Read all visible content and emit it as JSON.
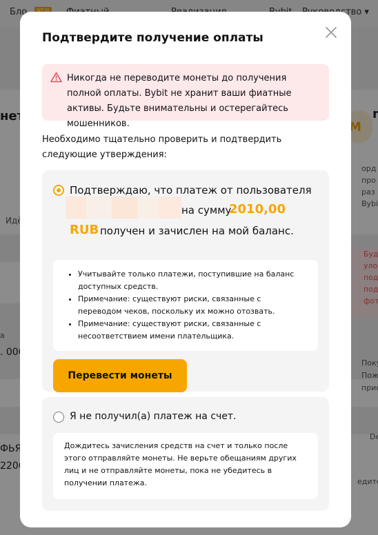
{
  "background": {
    "nav": [
      "Бло",
      "Фиатный",
      "Реализация",
      "Bybit",
      "Руководство ▾"
    ],
    "new_badge": "NEW",
    "left_fragments": [
      "неть",
      "Идё",
      "а",
      ". 000",
      "ФЬЯ",
      "2206"
    ],
    "right_fragments": [
      "n",
      "орд",
      "про",
      "раз",
      "Bybi",
      "Буд",
      "уло",
      "под",
      "под",
      "фот",
      "Поку",
      "Пож",
      "прис",
      "De",
      "едите"
    ],
    "avatar_letter": "M"
  },
  "modal": {
    "title": "Подтвердите получение оплаты",
    "alert_text": "Никогда не переводите монеты до получения полной оплаты. Bybit не хранит ваши фиатные активы. Будьте внимательны и остерегайтесь мошенников.",
    "intro_text": "Необходимо тщательно проверить и подтвердить следующие утверждения:",
    "option_confirm": {
      "line1": "Подтверждаю, что платеж от пользователя",
      "line2_mid": "на сумму",
      "amount": "2010,00",
      "currency": "RUB",
      "line3_rest": "получен и зачислен на мой баланс.",
      "selected": true,
      "notes": [
        "Учитывайте только платежи, поступившие на баланс доступных средств.",
        "Примечание: существуют риски, связанные с переводом чеков, поскольку их можно отозвать.",
        "Примечание: существуют риски, связанные с несоответствием имени плательщика."
      ],
      "button_label": "Перевести монеты"
    },
    "option_not_received": {
      "label": "Я не получил(а) платеж на счет.",
      "selected": false,
      "note": "Дождитесь зачисления средств на счет и только после этого отправляйте монеты. Не верьте обещаниям других лиц и не отправляйте монеты, пока не убедитесь в получении платежа."
    }
  },
  "colors": {
    "accent": "#f7a600",
    "alert_bg": "#fde8ea",
    "alert_icon": "#e84b5a",
    "card_bg": "#f4f4f5"
  },
  "icons": {
    "close": "close-icon",
    "alert": "warning-triangle-icon"
  }
}
